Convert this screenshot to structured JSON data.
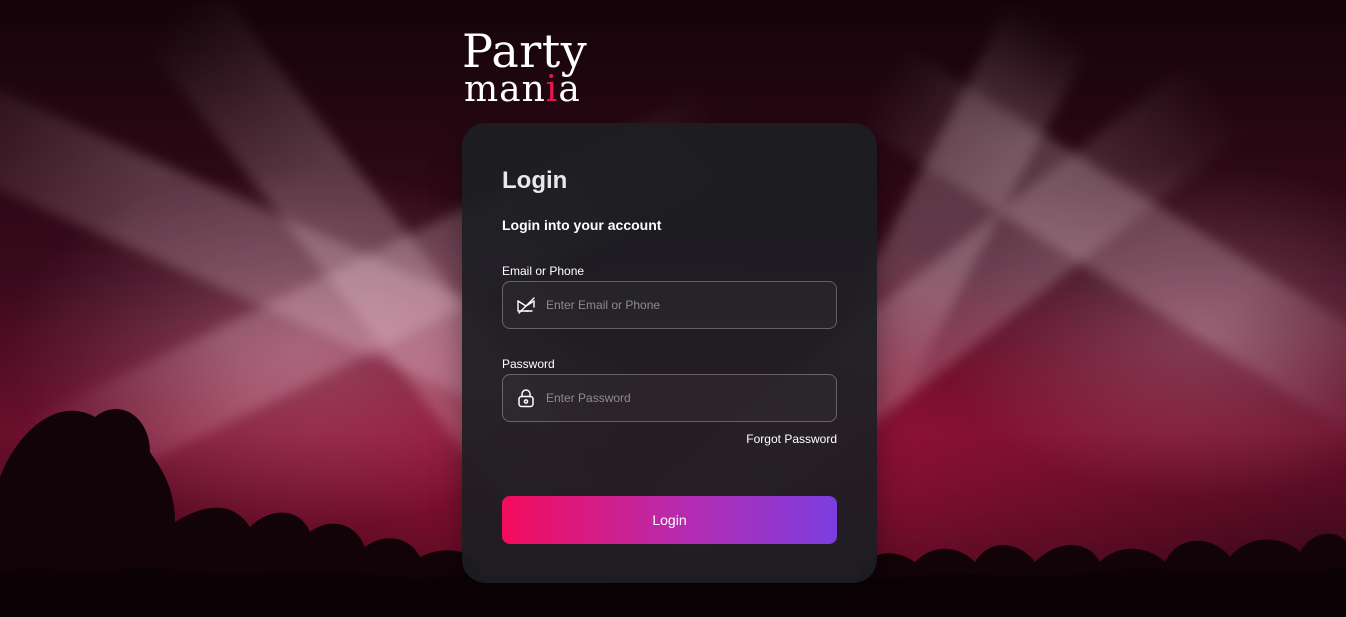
{
  "brand": {
    "line1": "Party",
    "line2_start": "man",
    "line2_accent": "i",
    "line2_end": "a",
    "accent_color": "#e8174f"
  },
  "login_card": {
    "title": "Login",
    "subtitle": "Login into your account",
    "email": {
      "label": "Email or Phone",
      "placeholder": "Enter Email or Phone",
      "value": "",
      "icon": "email-icon"
    },
    "password": {
      "label": "Password",
      "placeholder": "Enter Password",
      "value": "",
      "icon": "lock-icon"
    },
    "forgot_label": "Forgot Password",
    "submit_label": "Login"
  },
  "colors": {
    "button_gradient_start": "#f40c5c",
    "button_gradient_end": "#7c3ee0",
    "card_bg": "#1c1e22"
  }
}
